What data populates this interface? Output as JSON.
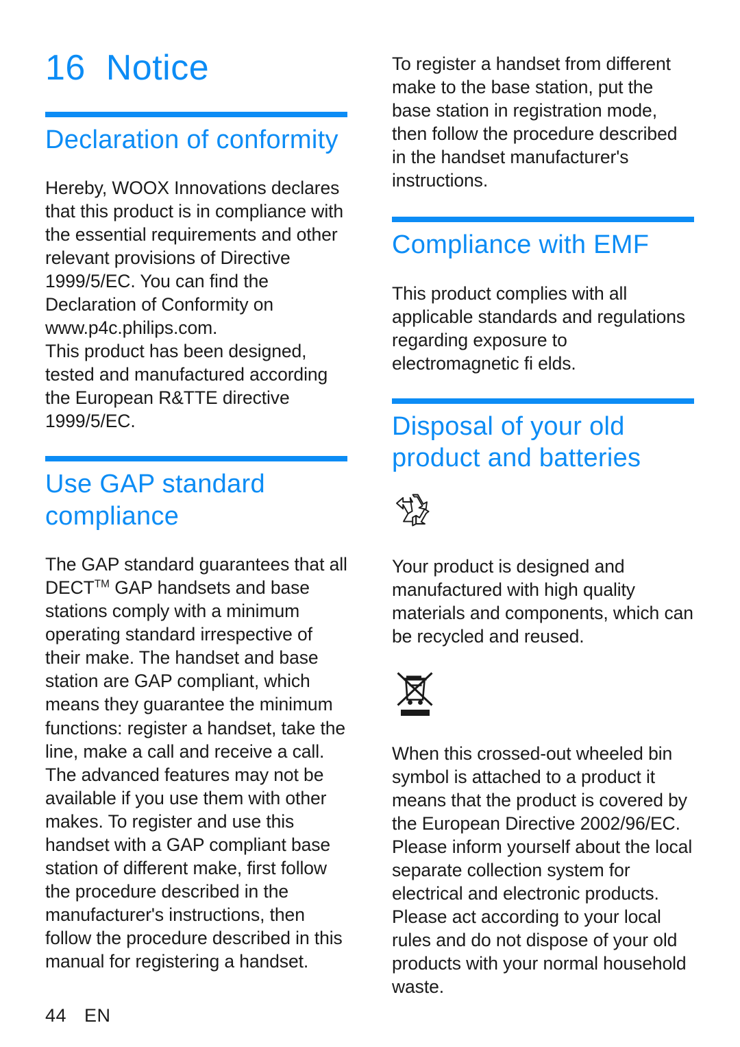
{
  "page": {
    "chapter_number": "16",
    "chapter_title": "Notice",
    "chapter_title_full": "16  Notice",
    "footer_page_number": "44",
    "footer_language": "EN",
    "accent_color": "#0c8cf5",
    "text_color": "#1a1a1a",
    "background_color": "#ffffff"
  },
  "left_column": {
    "declaration": {
      "heading": "Declaration of conformity",
      "paragraph_1": "Hereby, WOOX Innovations declares that this product is in compliance with the essential requirements and other relevant provisions of Directive 1999/5/EC. You can find the Declaration of Conformity on www.p4c.philips.com.",
      "paragraph_2": "This product has been designed, tested and manufactured according the European R&TTE directive 1999/5/EC."
    },
    "gap": {
      "heading": "Use GAP standard compliance",
      "paragraph_1_part_a": "The GAP standard guarantees that all DECT",
      "paragraph_1_tm": "TM",
      "paragraph_1_part_b": " GAP handsets and base stations comply with a minimum operating standard irrespective of their make. The handset and base station are GAP compliant, which means they guarantee the minimum functions: register a handset, take the line, make a call and receive a call. The advanced features may not be available if you use them with other makes. To register and use this handset with a GAP compliant base station of different make, first follow the procedure described in the manufacturer's instructions, then follow the procedure described in this manual for registering a handset."
    }
  },
  "right_column": {
    "registration_paragraph": "To register a handset from different make to the base station, put the base station in registration mode, then follow the procedure described in the handset manufacturer's instructions.",
    "emf": {
      "heading": "Compliance with EMF",
      "paragraph": "This product complies with all applicable standards and regulations regarding exposure to electromagnetic fi elds."
    },
    "disposal": {
      "heading": "Disposal of your old product and batteries",
      "recycle_icon_name": "recycling-symbol-icon",
      "paragraph_1": "Your product is designed and manufactured with high quality materials and components, which can be recycled and reused.",
      "weee_icon_name": "crossed-out-wheeled-bin-icon",
      "paragraph_2": "When this crossed-out wheeled bin symbol is attached to a product it means that the product is covered by the European Directive 2002/96/EC. Please inform yourself about the local separate collection system for electrical and electronic products. Please act according to your local rules and do not dispose of your old products with your normal household waste."
    }
  }
}
